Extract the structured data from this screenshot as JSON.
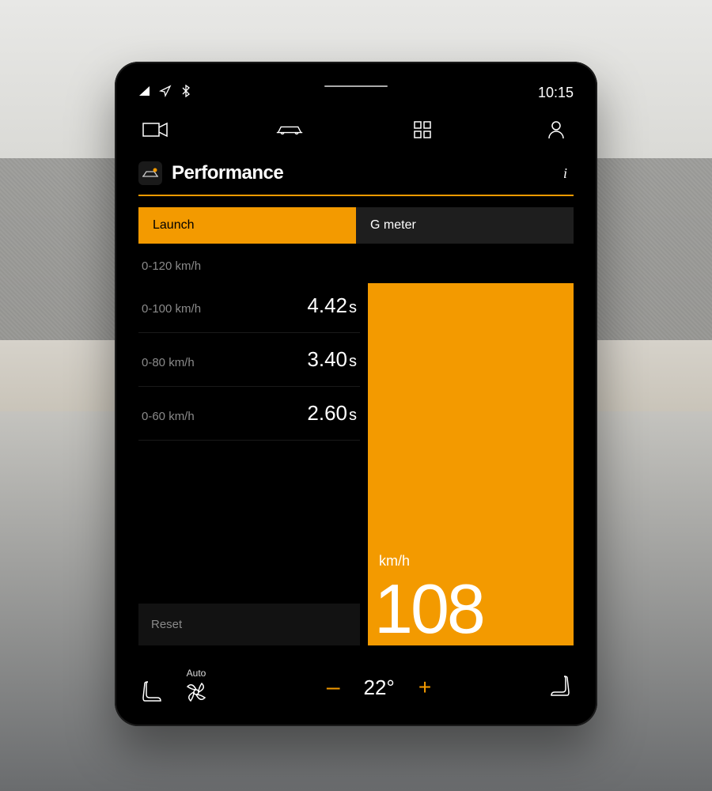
{
  "status": {
    "time": "10:15"
  },
  "app": {
    "title": "Performance",
    "info_label": "i"
  },
  "tabs": [
    {
      "label": "Launch",
      "active": true
    },
    {
      "label": "G meter",
      "active": false
    }
  ],
  "metrics": {
    "headline_label": "0-120 km/h",
    "rows": [
      {
        "label": "0-100 km/h",
        "value": "4.42",
        "unit": "s"
      },
      {
        "label": "0-80 km/h",
        "value": "3.40",
        "unit": "s"
      },
      {
        "label": "0-60 km/h",
        "value": "2.60",
        "unit": "s"
      }
    ],
    "reset_label": "Reset"
  },
  "speed": {
    "unit": "km/h",
    "value": "108"
  },
  "climate": {
    "fan_mode": "Auto",
    "temperature": "22°",
    "minus": "–",
    "plus": "+"
  }
}
